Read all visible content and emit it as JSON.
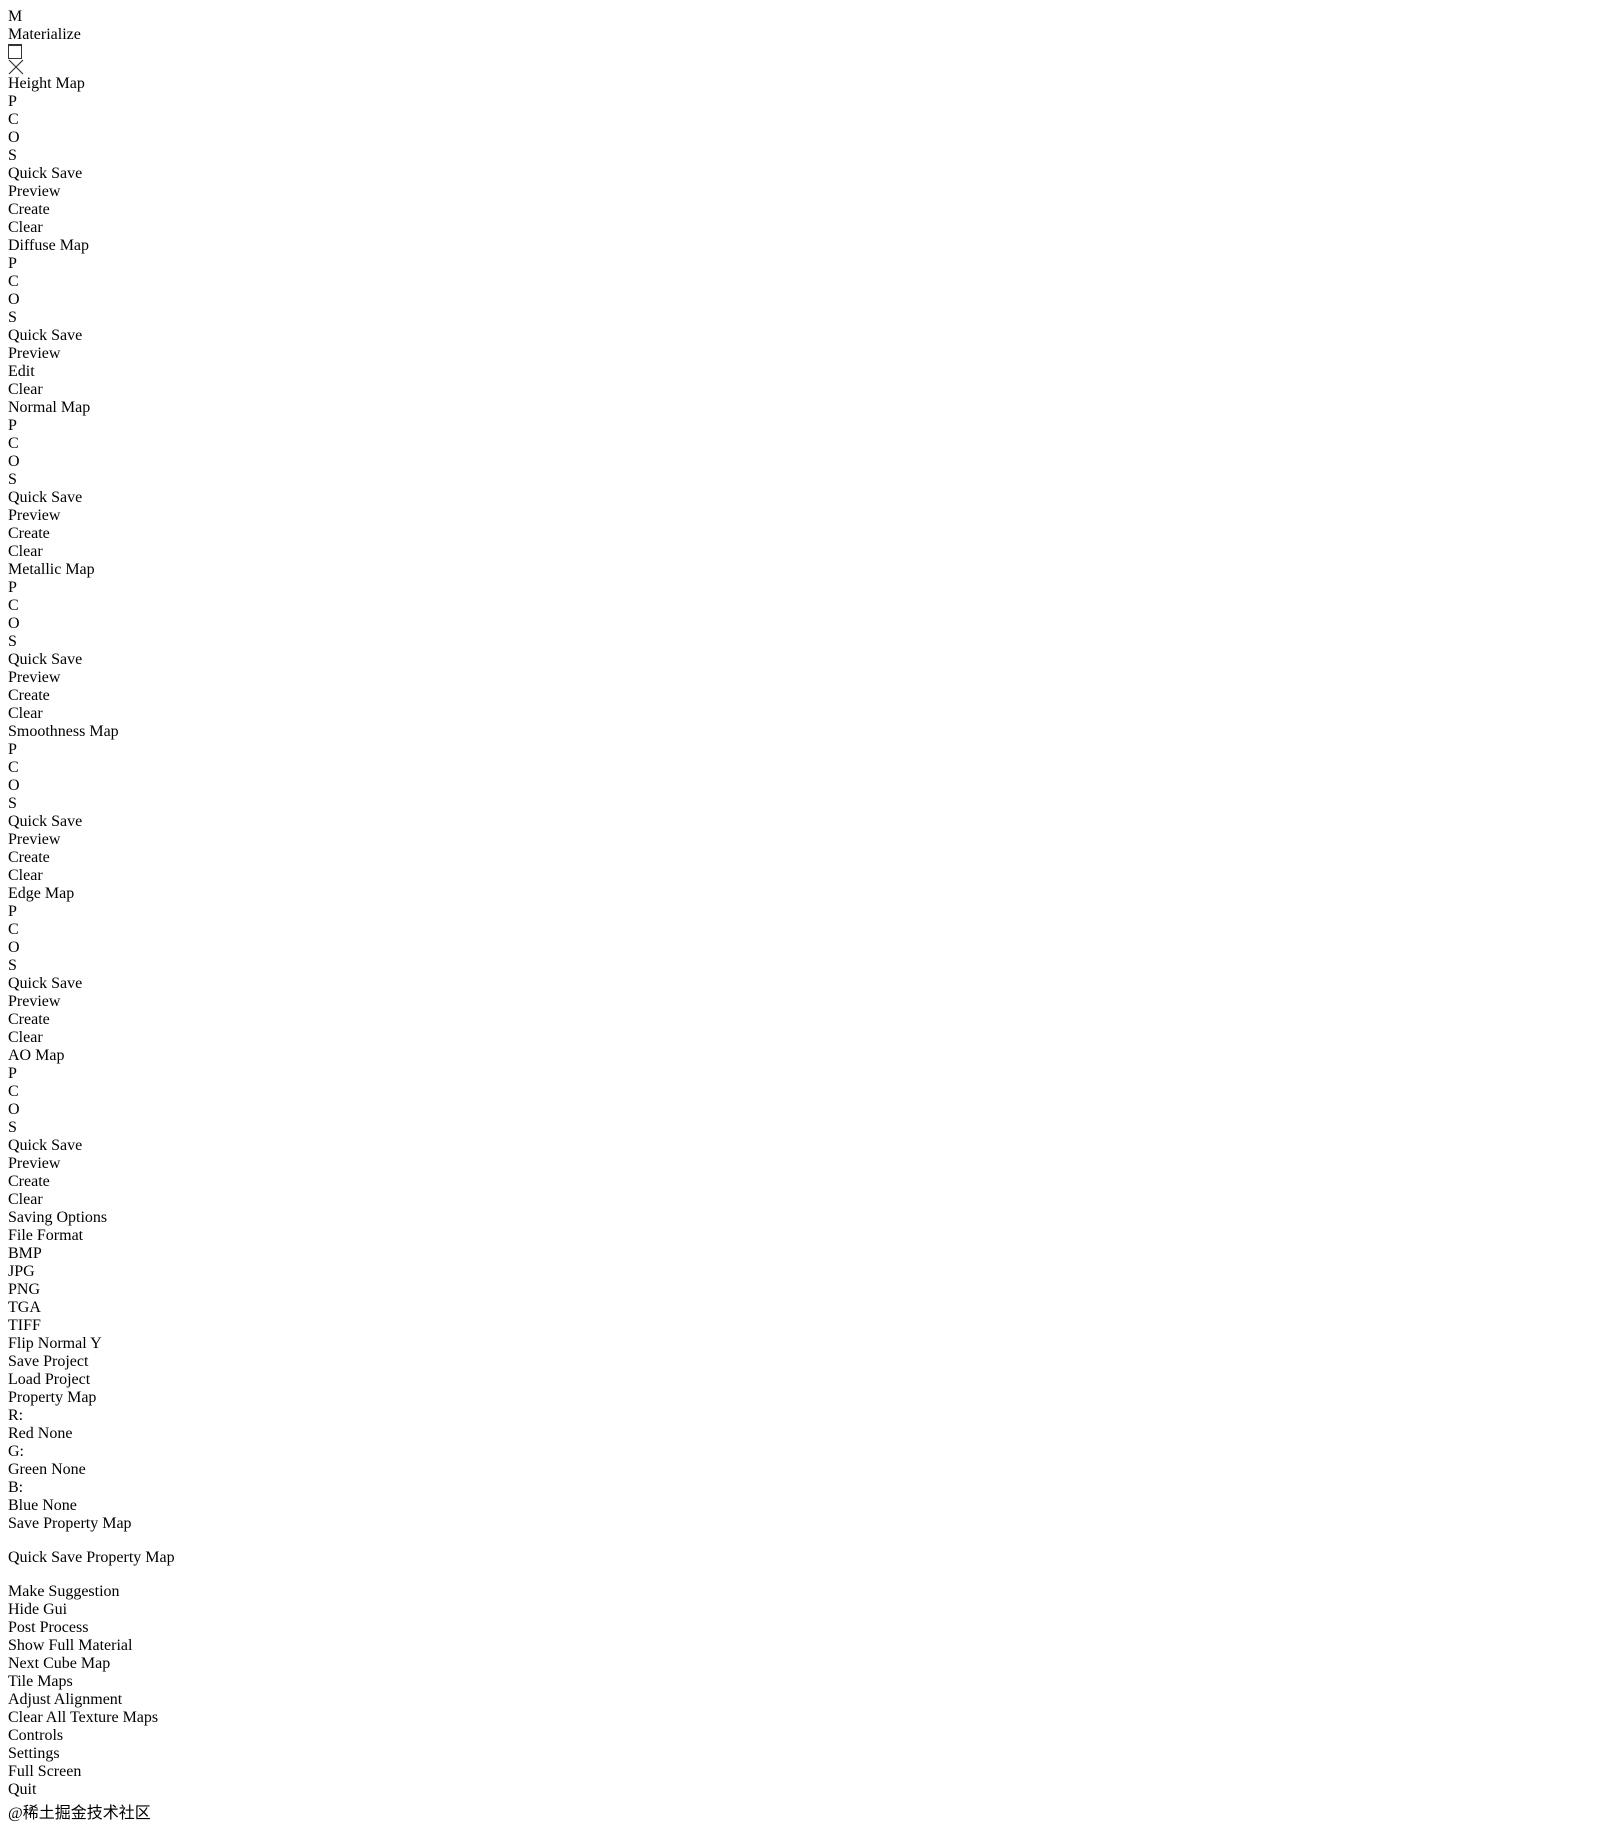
{
  "window": {
    "title": "Materialize",
    "logo_letter": "M"
  },
  "top_right": {
    "make_suggestion": "Make Suggestion",
    "hide_gui": "Hide Gui"
  },
  "map_panels": [
    {
      "title": "Height Map",
      "p": "P",
      "c": "C",
      "o": "O",
      "s": "S",
      "quick_save": "Quick Save",
      "preview": "Preview",
      "action1": "Create",
      "action2": "Clear"
    },
    {
      "title": "Diffuse Map",
      "p": "P",
      "c": "C",
      "o": "O",
      "s": "S",
      "quick_save": "Quick Save",
      "preview": "Preview",
      "action1": "Edit",
      "action2": "Clear"
    },
    {
      "title": "Normal Map",
      "p": "P",
      "c": "C",
      "o": "O",
      "s": "S",
      "quick_save": "Quick Save",
      "preview": "Preview",
      "action1": "Create",
      "action2": "Clear"
    },
    {
      "title": "Metallic Map",
      "p": "P",
      "c": "C",
      "o": "O",
      "s": "S",
      "quick_save": "Quick Save",
      "preview": "Preview",
      "action1": "Create",
      "action2": "Clear"
    },
    {
      "title": "Smoothness Map",
      "p": "P",
      "c": "C",
      "o": "O",
      "s": "S",
      "quick_save": "Quick Save",
      "preview": "Preview",
      "action1": "Create",
      "action2": "Clear"
    },
    {
      "title": "Edge Map",
      "p": "P",
      "c": "C",
      "o": "O",
      "s": "S",
      "quick_save": "Quick Save",
      "preview": "Preview",
      "action1": "Create",
      "action2": "Clear"
    },
    {
      "title": "AO Map",
      "p": "P",
      "c": "C",
      "o": "O",
      "s": "S",
      "quick_save": "Quick Save",
      "preview": "Preview",
      "action1": "Create",
      "action2": "Clear"
    }
  ],
  "saving_options": {
    "title": "Saving Options",
    "file_format_label": "File Format",
    "property_map_label": "Property Map",
    "formats": [
      "BMP",
      "JPG",
      "PNG",
      "TGA",
      "TIFF"
    ],
    "selected_format": "PNG",
    "r_label": "R:",
    "g_label": "G:",
    "b_label": "B:",
    "red_none": "Red None",
    "green_none": "Green None",
    "blue_none": "Blue None",
    "flip_normal_y": "Flip Normal Y",
    "save_project": "Save Project",
    "load_project": "Load Project",
    "save_property_map_line1": "Save",
    "save_property_map_line2": "Property Map",
    "quick_save_property_map_line1": "Quick Save",
    "quick_save_property_map_line2": "Property Map"
  },
  "toolbar": {
    "post_process": "Post Process",
    "show_full_material_1": "Show Full",
    "show_full_material_2": "Material",
    "next_cube_map_1": "Next",
    "next_cube_map_2": "Cube Map",
    "tile_maps_1": "Tile",
    "tile_maps_2": "Maps",
    "adjust_alignment_1": "Adjust",
    "adjust_alignment_2": "Alignment",
    "clear_all_1": "Clear All",
    "clear_all_2": "Texture Maps"
  },
  "bottom": {
    "controls": "Controls",
    "settings": "Settings",
    "full_screen": "Full Screen",
    "quit": "Quit"
  },
  "watermark": "@稀土掘金技术社区",
  "colors": {
    "panel_bg": "#1c1e1e",
    "button_bg": "#2a2c2c",
    "text": "#e8e8e8",
    "disabled_text": "#8a8a8a"
  }
}
